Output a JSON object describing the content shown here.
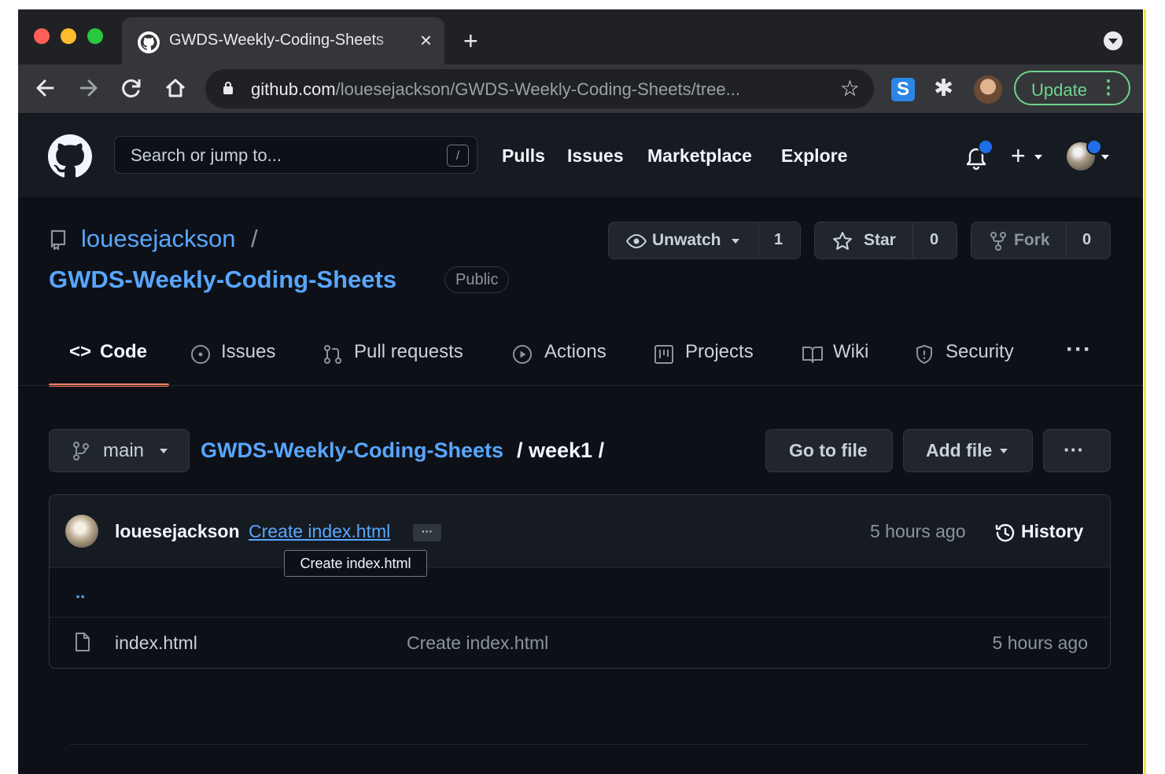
{
  "browser": {
    "tab_title": "GWDS-Weekly-Coding-Sheets",
    "tab_close": "×",
    "new_tab": "+",
    "url_host": "github.com",
    "url_path": "/louesejackson/GWDS-Weekly-Coding-Sheets/tree...",
    "update_label": "Update",
    "update_menu": "⋮",
    "extension_s": "S",
    "icons": [
      "back-icon",
      "forward-icon",
      "reload-icon",
      "home-icon",
      "lock-icon",
      "bookmark-star-icon",
      "extension-s-icon",
      "puzzle-icon",
      "profile-avatar",
      "tab-search-icon"
    ]
  },
  "header": {
    "search_placeholder": "Search or jump to...",
    "search_shortcut": "/",
    "nav": [
      "Pulls",
      "Issues",
      "Marketplace",
      "Explore"
    ],
    "plus": "+"
  },
  "repo": {
    "owner": "louesejackson",
    "separator": "/",
    "name": "GWDS-Weekly-Coding-Sheets",
    "visibility": "Public",
    "watch_label": "Unwatch",
    "watch_count": "1",
    "star_label": "Star",
    "star_count": "0",
    "fork_label": "Fork",
    "fork_count": "0"
  },
  "tabs": {
    "code": "Code",
    "issues": "Issues",
    "pulls": "Pull requests",
    "actions": "Actions",
    "projects": "Projects",
    "wiki": "Wiki",
    "security": "Security",
    "more": "···"
  },
  "path": {
    "branch": "main",
    "repo": "GWDS-Weekly-Coding-Sheets",
    "rest": "/ week1 /",
    "go_to_file": "Go to file",
    "add_file": "Add file",
    "more": "···"
  },
  "commit": {
    "author": "louesejackson",
    "message": "Create index.html",
    "ellipsis": "···",
    "time": "5 hours ago",
    "history": "History",
    "tooltip": "Create index.html"
  },
  "files": {
    "parent": "..",
    "rows": [
      {
        "name": "index.html",
        "message": "Create index.html",
        "time": "5 hours ago"
      }
    ]
  },
  "colors": {
    "accent_link": "#58a6ff",
    "tab_underline": "#f78166",
    "update_green": "#6dd58c",
    "notification_blue": "#1f6feb"
  }
}
